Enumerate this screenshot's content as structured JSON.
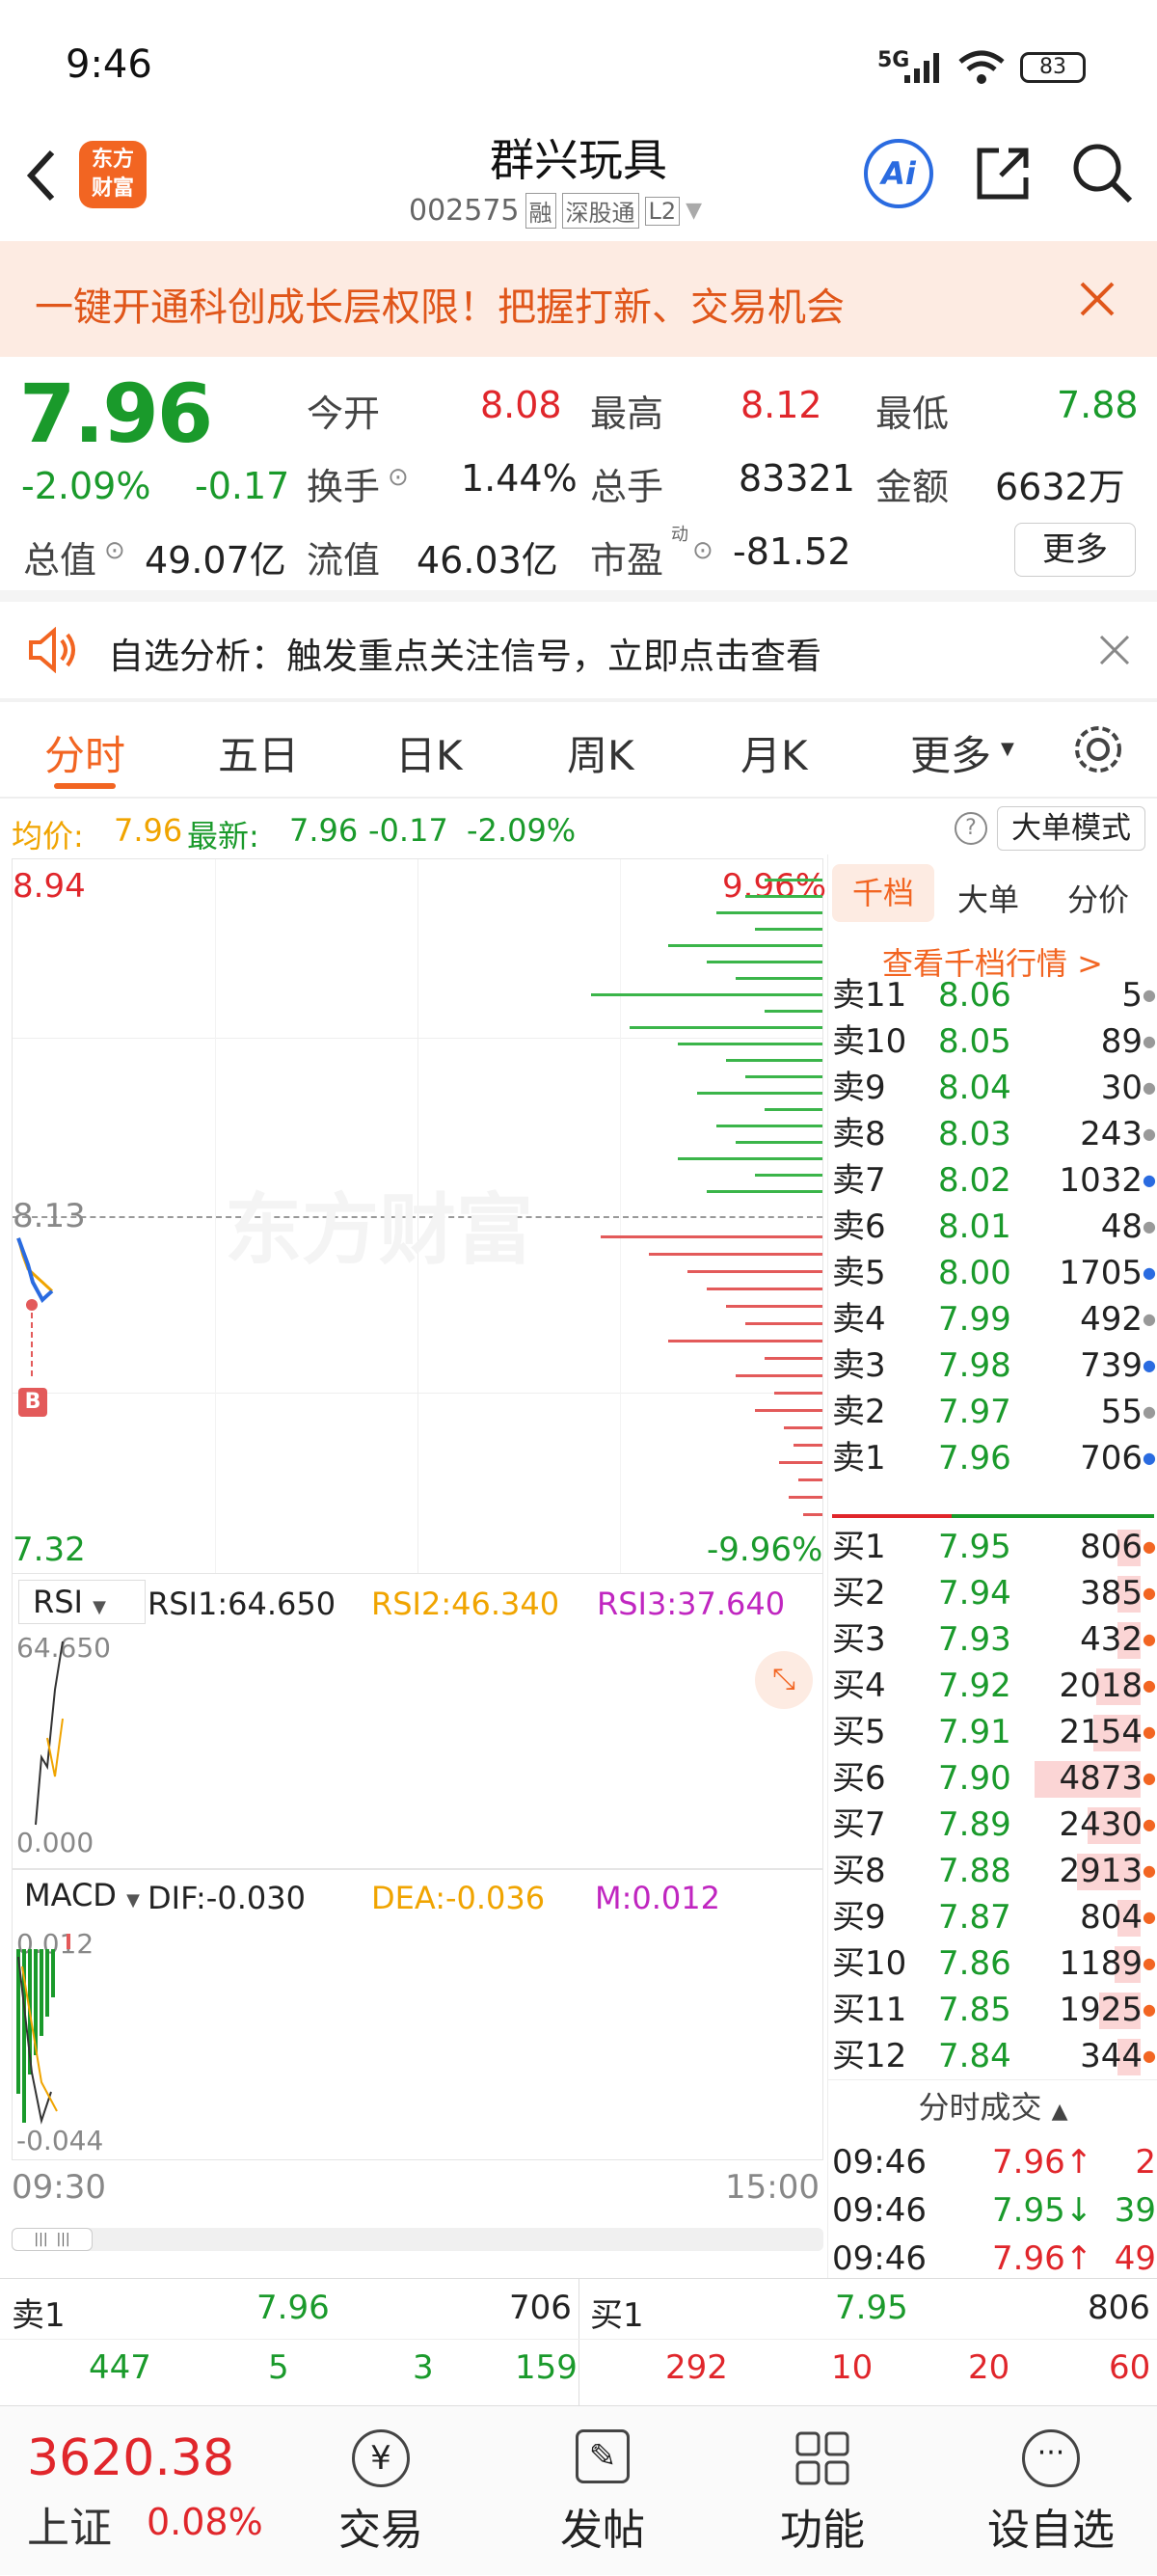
{
  "status": {
    "time": "9:46",
    "network": "5G",
    "battery": "83"
  },
  "header": {
    "title": "群兴玩具",
    "code": "002575",
    "tags": [
      "融",
      "深股通",
      "L2"
    ],
    "logo_line1": "东方",
    "logo_line2": "财富",
    "ai": "Ai"
  },
  "banner": {
    "text": "一键开通科创成长层权限！把握打新、交易机会"
  },
  "quote": {
    "price": "7.96",
    "pct": "-2.09%",
    "chg": "-0.17",
    "open_l": "今开",
    "open": "8.08",
    "high_l": "最高",
    "high": "8.12",
    "low_l": "最低",
    "low": "7.88",
    "turnover_l": "换手",
    "turnover": "1.44%",
    "vol_l": "总手",
    "vol": "83321",
    "amt_l": "金额",
    "amt": "6632万",
    "mcap_l": "总值",
    "mcap": "49.07亿",
    "float_l": "流值",
    "float": "46.03亿",
    "pe_l": "市盈",
    "pe_sup": "动",
    "pe": "-81.52",
    "more": "更多"
  },
  "notice": {
    "text": "自选分析：触发重点关注信号，立即点击查看"
  },
  "tabs": [
    "分时",
    "五日",
    "日K",
    "周K",
    "月K",
    "更多"
  ],
  "chart_info": {
    "avg_l": "均价:",
    "avg": "7.96",
    "latest_l": "最新:",
    "latest": "7.96",
    "chg": "-0.17",
    "pct": "-2.09%",
    "mode": "大单模式"
  },
  "chart_data": [
    {
      "type": "line",
      "y_max": "8.94",
      "y_mid": "8.13",
      "y_min": "7.32",
      "pct_max": "9.96%",
      "pct_min": "-9.96%",
      "x_start": "09:30",
      "x_end": "15:00",
      "series": [
        {
          "values": [
            8.08,
            8.05,
            8.02,
            7.98,
            7.96,
            7.94,
            7.95,
            7.96
          ]
        },
        {
          "values": [
            8.08,
            8.04,
            8.01,
            8.0,
            7.99,
            7.98,
            7.97,
            7.96
          ]
        }
      ],
      "marker": "B"
    },
    {
      "type": "line",
      "indicator": "RSI",
      "rsi1": "RSI1:64.650",
      "rsi2": "RSI2:46.340",
      "rsi3": "RSI3:37.640",
      "y_max": "64.650",
      "y_min": "0.000"
    },
    {
      "type": "bar",
      "indicator": "MACD",
      "dif": "DIF:-0.030",
      "dea": "DEA:-0.036",
      "m": "M:0.012",
      "y_max": "0.012",
      "y_min": "-0.044"
    }
  ],
  "orderbook": {
    "tabs": [
      "千档",
      "大单",
      "分价"
    ],
    "link": "查看千档行情 >",
    "sells": [
      [
        "卖11",
        "8.06",
        "5"
      ],
      [
        "卖10",
        "8.05",
        "89"
      ],
      [
        "卖9",
        "8.04",
        "30"
      ],
      [
        "卖8",
        "8.03",
        "243"
      ],
      [
        "卖7",
        "8.02",
        "1032"
      ],
      [
        "卖6",
        "8.01",
        "48"
      ],
      [
        "卖5",
        "8.00",
        "1705"
      ],
      [
        "卖4",
        "7.99",
        "492"
      ],
      [
        "卖3",
        "7.98",
        "739"
      ],
      [
        "卖2",
        "7.97",
        "55"
      ],
      [
        "卖1",
        "7.96",
        "706"
      ]
    ],
    "buys": [
      [
        "买1",
        "7.95",
        "806"
      ],
      [
        "买2",
        "7.94",
        "385"
      ],
      [
        "买3",
        "7.93",
        "432"
      ],
      [
        "买4",
        "7.92",
        "2018"
      ],
      [
        "买5",
        "7.91",
        "2154"
      ],
      [
        "买6",
        "7.90",
        "4873"
      ],
      [
        "买7",
        "7.89",
        "2430"
      ],
      [
        "买8",
        "7.88",
        "2913"
      ],
      [
        "买9",
        "7.87",
        "804"
      ],
      [
        "买10",
        "7.86",
        "1189"
      ],
      [
        "买11",
        "7.85",
        "1925"
      ],
      [
        "买12",
        "7.84",
        "344"
      ]
    ]
  },
  "trades": {
    "title": "分时成交",
    "rows": [
      [
        "09:46",
        "7.96↑",
        "2"
      ],
      [
        "09:46",
        "7.95↓",
        "39"
      ],
      [
        "09:46",
        "7.96↑",
        "49"
      ]
    ]
  },
  "summary": {
    "sell_l": "卖1",
    "sell_p": "7.96",
    "sell_v": "706",
    "buy_l": "买1",
    "buy_p": "7.95",
    "buy_v": "806",
    "row2": [
      "447",
      "5",
      "3",
      "159",
      "292",
      "10",
      "20",
      "60"
    ]
  },
  "bottom": {
    "index_val": "3620.38",
    "index_name": "上证",
    "index_pct": "0.08%",
    "nav": [
      "交易",
      "发帖",
      "功能",
      "设自选"
    ]
  }
}
